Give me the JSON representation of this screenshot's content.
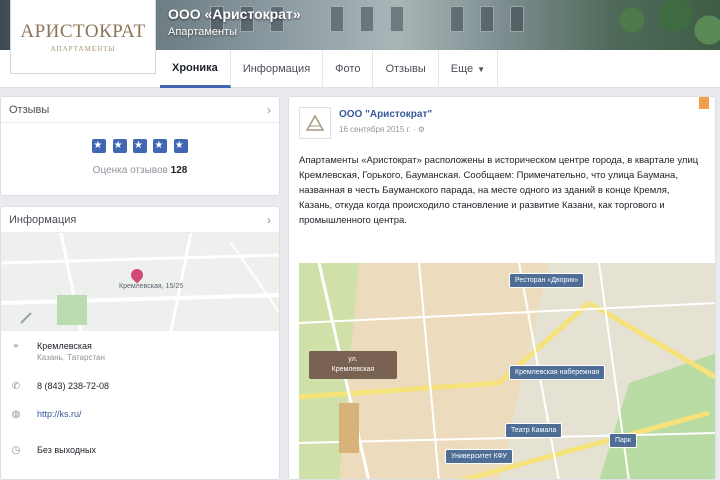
{
  "page": {
    "name": "ООО «Аристократ»",
    "subtitle": "Апартаменты"
  },
  "logo": {
    "brand": "АРИСТОКРАТ",
    "brand_sub": "АПАРТАМЕНТЫ"
  },
  "tabs": [
    {
      "label": "Хроника",
      "active": true
    },
    {
      "label": "Информация",
      "active": false
    },
    {
      "label": "Фото",
      "active": false
    },
    {
      "label": "Отзывы",
      "active": false
    },
    {
      "label": "Еще",
      "active": false,
      "caret": true
    }
  ],
  "reviews_card": {
    "title": "Отзывы",
    "stars": 5,
    "rating_text": "Оценка отзывов",
    "rating_count": "128"
  },
  "info_card": {
    "title": "Информация",
    "map_pin_label": "Кремлевская, 15/25",
    "rows": [
      {
        "icon": "location-icon",
        "text": "Кремлевская",
        "sub": "Казань, Татарстан"
      },
      {
        "icon": "phone-icon",
        "text": "8 (843) 238-72-08"
      },
      {
        "icon": "globe-icon",
        "text": "http://ks.ru/"
      },
      {
        "icon": "clock-icon",
        "text": "Без выходных"
      }
    ]
  },
  "post": {
    "author": "ООО \"Аристократ\"",
    "date": "16 сентября 2015 г. · ⚙",
    "text": "Апартаменты «Аристократ» расположены в историческом центре города, в квартале улиц Кремлевская, Горького, Бауманская. Сообщаем: Примечательно, что улица Баумана, названная в честь Бауманского парада, на месте одного из зданий в конце Кремля, Казань, откуда когда происходило становление и развитие Казани, как торгового и промышленного центра.",
    "map": {
      "main_label_1": "ул.",
      "main_label_2": "Кремлевская",
      "callouts": [
        "Ресторан «Дворик»",
        "Кремлевская набережная",
        "Театр Камала",
        "Университет КФУ",
        "Парк"
      ]
    }
  }
}
